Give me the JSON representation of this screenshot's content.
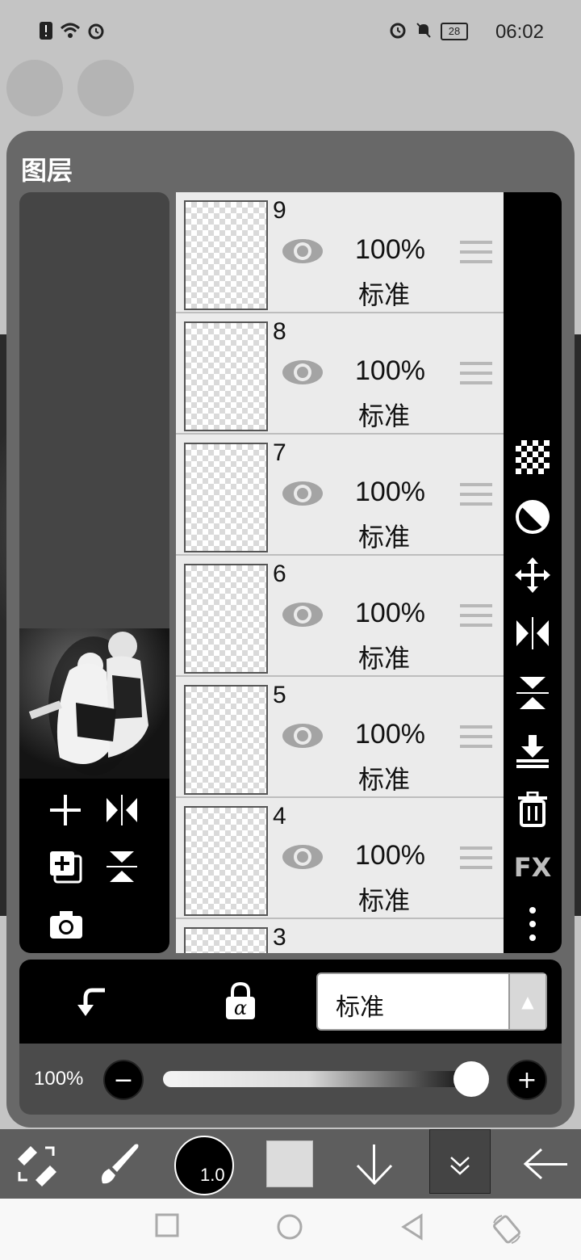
{
  "status_bar": {
    "time": "06:02",
    "battery": "28"
  },
  "panel": {
    "title": "图层"
  },
  "layers": [
    {
      "name": "9",
      "opacity": "100%",
      "mode": "标准"
    },
    {
      "name": "8",
      "opacity": "100%",
      "mode": "标准"
    },
    {
      "name": "7",
      "opacity": "100%",
      "mode": "标准"
    },
    {
      "name": "6",
      "opacity": "100%",
      "mode": "标准"
    },
    {
      "name": "5",
      "opacity": "100%",
      "mode": "标准"
    },
    {
      "name": "4",
      "opacity": "100%",
      "mode": "标准"
    },
    {
      "name": "3"
    }
  ],
  "right_tools": [
    "checker-icon",
    "half-circle-icon",
    "move-icon",
    "flip-horizontal-icon",
    "flip-vertical-icon",
    "merge-down-icon",
    "trash-icon",
    "fx-icon",
    "more-icon"
  ],
  "fx_label": "FX",
  "blend_mode": {
    "value": "标准"
  },
  "opacity": {
    "label": "100%",
    "value_fraction": 1.0
  },
  "toolbar": {
    "brush_size": "1.0"
  },
  "colors": {
    "panel_bg": "#686868",
    "layer_row": "#ebebeb",
    "accent_white": "#ffffff"
  }
}
